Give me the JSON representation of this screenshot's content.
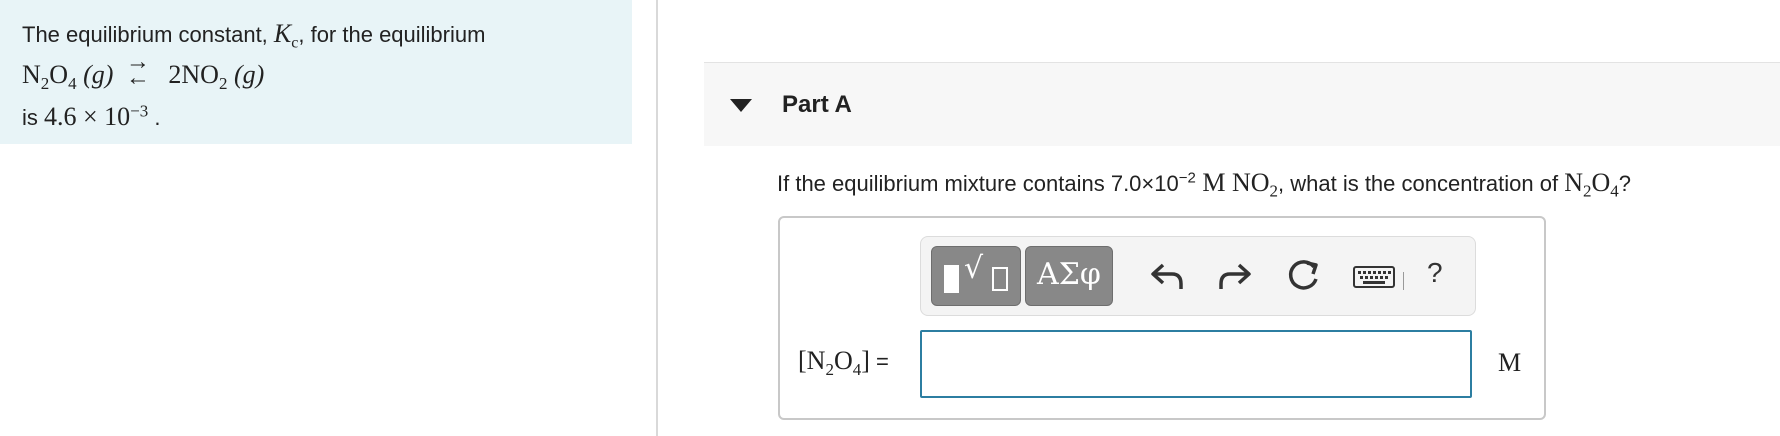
{
  "intro": {
    "line1_prefix": "The equilibrium constant, ",
    "k_symbol": "K",
    "k_sub": "c",
    "line1_suffix": ", for the equilibrium",
    "reactant": "N",
    "reactant_sub1": "2",
    "reactant_o": "O",
    "reactant_sub2": "4",
    "phase_reactant": "(g)",
    "arrow_forward": "→",
    "arrow_back": "←",
    "product": "2NO",
    "product_sub": "2",
    "phase_product": "(g)",
    "is_label": "is ",
    "k_mantissa": "4.6 × 10",
    "k_exponent": "−3",
    "period": " ."
  },
  "part": {
    "title": "Part A"
  },
  "question": {
    "prefix": "If the equilibrium mixture contains ",
    "conc": "7.0×10",
    "conc_exp": "−2",
    "unit": " M NO",
    "unit_sub": "2",
    "middle": ", what is the concentration of ",
    "target": "N",
    "target_sub1": "2",
    "target_o": "O",
    "target_sub2": "4",
    "suffix": "?"
  },
  "toolbar": {
    "symbols_label": "ΑΣφ",
    "help_label": "?"
  },
  "answer": {
    "label_open": "[N",
    "label_sub1": "2",
    "label_o": "O",
    "label_sub2": "4",
    "label_close": "]",
    "equals": " =",
    "input_value": "",
    "unit": "M"
  }
}
